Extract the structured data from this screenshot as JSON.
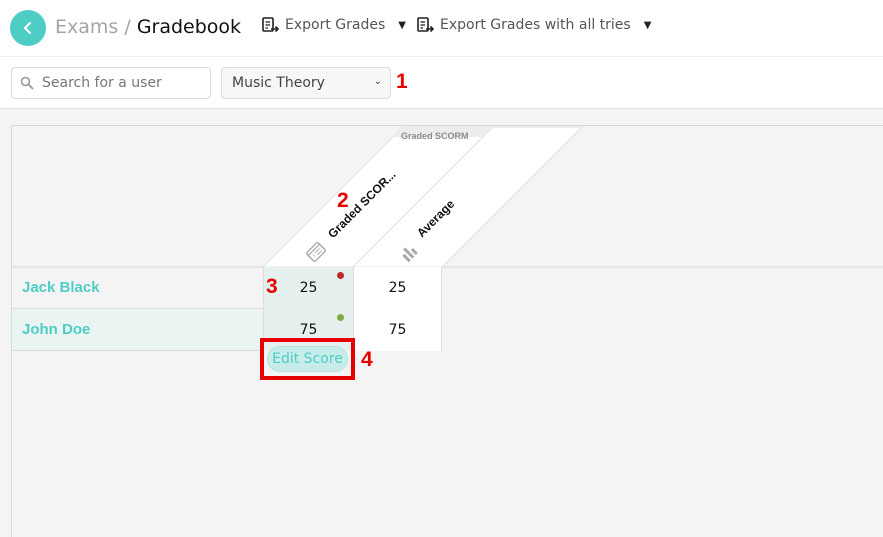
{
  "header": {
    "breadcrumb_parent": "Exams",
    "breadcrumb_separator": "/",
    "page_title": "Gradebook",
    "back_icon": "chevron-left-icon",
    "export_grades_label": "Export Grades",
    "export_grades_all_tries_label": "Export Grades with all tries",
    "export_icon": "export-file-icon"
  },
  "filters": {
    "search_placeholder": "Search for a user",
    "search_value": "",
    "course_select_value": "Music Theory"
  },
  "gradebook": {
    "group_label": "Graded SCORM",
    "columns": [
      {
        "label": "Graded SCOR...",
        "icon": "scorm-quiz-icon"
      },
      {
        "label": "Average",
        "icon": "bar-chart-icon"
      }
    ],
    "rows": [
      {
        "name": "Jack Black",
        "score": "25",
        "average": "25",
        "status_color": "#c0282d"
      },
      {
        "name": "John Doe",
        "score": "75",
        "average": "75",
        "status_color": "#7cac3e"
      }
    ],
    "edit_score_label": "Edit Score"
  },
  "annotations": [
    "1",
    "2",
    "3",
    "4"
  ],
  "colors": {
    "accent": "#4ecdc4",
    "annotation": "#e60000"
  }
}
